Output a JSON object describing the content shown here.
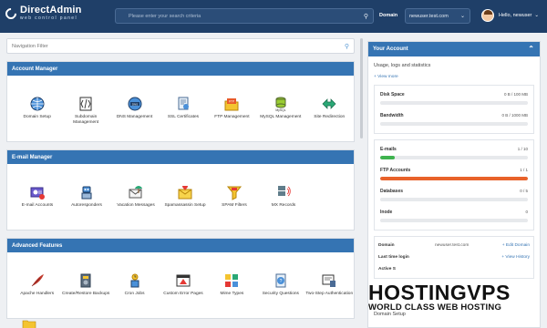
{
  "header": {
    "logo_title": "DirectAdmin",
    "logo_subtitle": "web control panel",
    "search_placeholder": "Please enter your search criteria",
    "domain_label": "Domain",
    "domain_value": "newuser.test.com",
    "greeting": "Hello, newuser"
  },
  "main": {
    "nav_filter_placeholder": "Navigation Filter",
    "sections": [
      {
        "title": "Account Manager",
        "items": [
          {
            "label": "Domain Setup",
            "icon": "globe-icon"
          },
          {
            "label": "Subdomain Management",
            "icon": "subdomain-icon"
          },
          {
            "label": "DNS Management",
            "icon": "dns-icon"
          },
          {
            "label": "SSL Certificates",
            "icon": "ssl-icon"
          },
          {
            "label": "FTP Management",
            "icon": "ftp-icon"
          },
          {
            "label": "MySQL Management",
            "icon": "mysql-icon"
          },
          {
            "label": "Site Redirection",
            "icon": "redirect-icon"
          }
        ]
      },
      {
        "title": "E-mail Manager",
        "items": [
          {
            "label": "E-mail Accounts",
            "icon": "email-accounts-icon"
          },
          {
            "label": "Autoresponders",
            "icon": "robot-icon"
          },
          {
            "label": "Vacation Messages",
            "icon": "vacation-icon"
          },
          {
            "label": "Spamassassin Setup",
            "icon": "spam-setup-icon"
          },
          {
            "label": "SPAM Filters",
            "icon": "spam-filter-icon"
          },
          {
            "label": "MX Records",
            "icon": "mx-icon"
          }
        ]
      },
      {
        "title": "Advanced Features",
        "items": [
          {
            "label": "Apache Handlers",
            "icon": "feather-icon"
          },
          {
            "label": "Create/Restore Backups",
            "icon": "backup-icon"
          },
          {
            "label": "Cron Jobs",
            "icon": "cron-icon"
          },
          {
            "label": "Custom Error Pages",
            "icon": "error-page-icon"
          },
          {
            "label": "Mime Types",
            "icon": "mime-icon"
          },
          {
            "label": "Security Questions",
            "icon": "security-icon"
          },
          {
            "label": "Two-Step Authentication",
            "icon": "two-step-icon"
          }
        ]
      }
    ]
  },
  "sidebar": {
    "title": "Your Account",
    "subtitle": "Usage, logs and statistics",
    "view_more": "+ View more",
    "stats_1": [
      {
        "label": "Disk Space",
        "value": "0 B / 100 MB",
        "fraction": 0,
        "color": "#3574b3"
      },
      {
        "label": "Bandwidth",
        "value": "0 B / 1000 MB",
        "fraction": 0,
        "color": "#3574b3"
      }
    ],
    "stats_2": [
      {
        "label": "E-mails",
        "value": "1 / 10",
        "fraction": 0.1,
        "color": "#3fb34f"
      },
      {
        "label": "FTP Accounts",
        "value": "1 / 1",
        "fraction": 1,
        "color": "#e8622a"
      },
      {
        "label": "Databases",
        "value": "0 / 5",
        "fraction": 0,
        "color": "#3574b3"
      },
      {
        "label": "Inode",
        "value": "0",
        "fraction": 0,
        "color": "#3574b3"
      }
    ],
    "info": {
      "domain_label": "Domain",
      "domain_value": "newuser.test.com",
      "edit_link": "+ Edit Domain",
      "last_login_label": "Last time login",
      "history_link": "+ View History",
      "active_label": "Active S"
    },
    "domain_setup": "Domain Setup"
  },
  "watermark": {
    "line1": "HOSTINGVPS",
    "line2": "WORLD CLASS WEB HOSTING"
  }
}
